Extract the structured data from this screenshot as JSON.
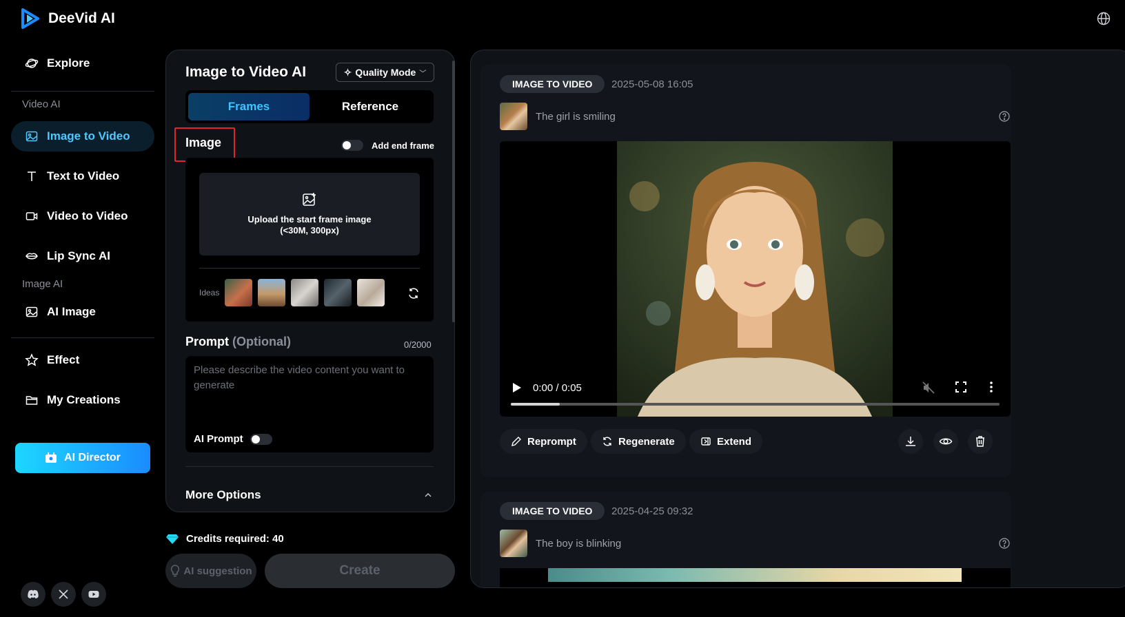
{
  "app": {
    "name": "DeeVid AI",
    "accent": "#1a8cff"
  },
  "sidebar": {
    "explore": "Explore",
    "section_video": "Video AI",
    "image_to_video": "Image to Video",
    "text_to_video": "Text to Video",
    "video_to_video": "Video to Video",
    "lip_sync": "Lip Sync AI",
    "section_image": "Image AI",
    "ai_image": "AI Image",
    "effect": "Effect",
    "my_creations": "My Creations",
    "ai_director": "AI Director"
  },
  "form": {
    "title": "Image to Video AI",
    "quality_mode": "Quality Mode",
    "tabs": [
      "Frames",
      "Reference"
    ],
    "image_label": "Image",
    "add_end_frame": "Add end frame",
    "upload_line1": "Upload the start frame image",
    "upload_line2": "(<30M, 300px)",
    "ideas_label": "Ideas",
    "prompt_label": "Prompt",
    "prompt_optional": "(Optional)",
    "prompt_count": "0/2000",
    "prompt_placeholder": "Please describe the video content you want to generate",
    "ai_prompt": "AI Prompt",
    "more_options": "More Options",
    "credits": "Credits required: 40",
    "ai_suggestion": "AI suggestion",
    "create": "Create"
  },
  "results": [
    {
      "badge": "IMAGE TO VIDEO",
      "date": "2025-05-08 16:05",
      "prompt": "The girl is smiling",
      "time": "0:00 / 0:05",
      "progress": 0.1,
      "actions": [
        "Reprompt",
        "Regenerate",
        "Extend"
      ]
    },
    {
      "badge": "IMAGE TO VIDEO",
      "date": "2025-04-25 09:32",
      "prompt": "The boy is blinking"
    }
  ]
}
